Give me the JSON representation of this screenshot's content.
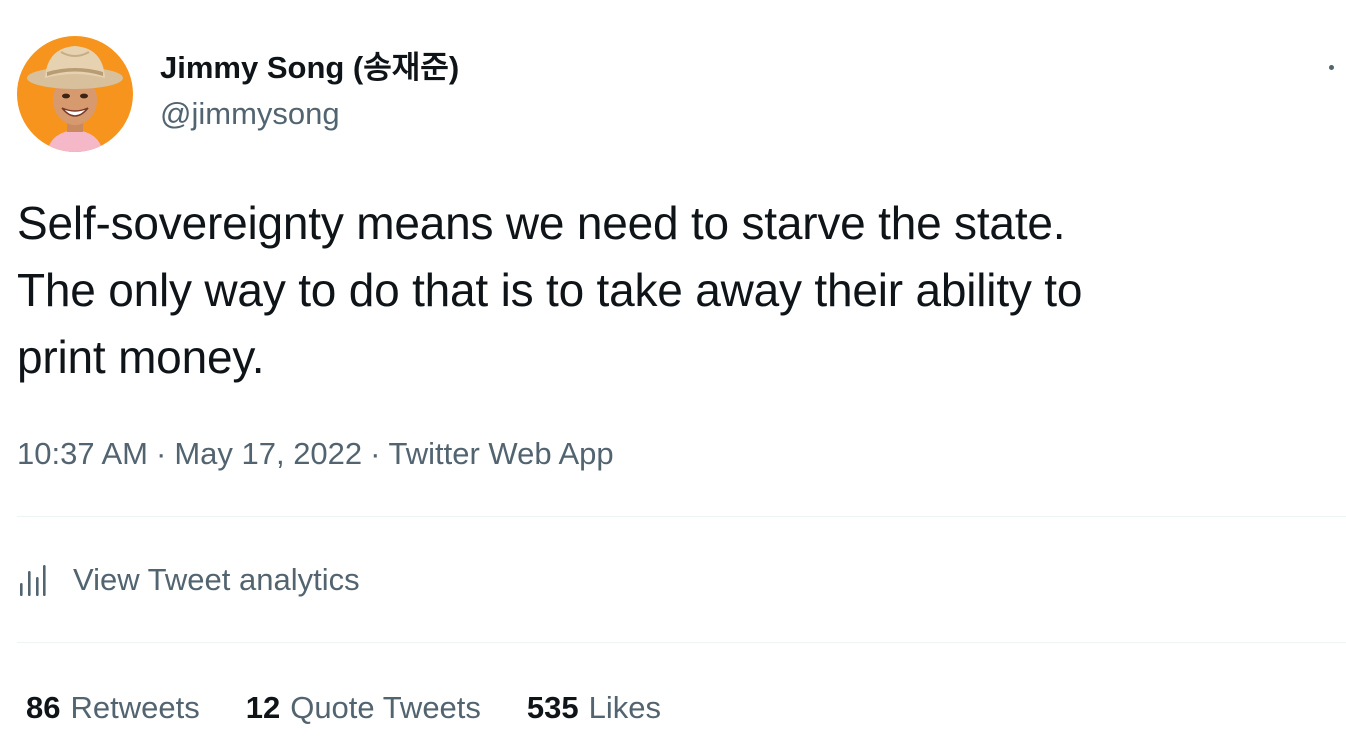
{
  "author": {
    "display_name": "Jimmy Song (송재준)",
    "handle": "@jimmysong"
  },
  "tweet": {
    "lines": [
      "Self-sovereignty means we need to starve the state.",
      "The only way to do that is to take away their ability to",
      "print money."
    ]
  },
  "meta": {
    "time": "10:37 AM",
    "separator": "·",
    "date": "May 17, 2022",
    "source": "Twitter Web App"
  },
  "analytics": {
    "icon": "analytics-bars-icon",
    "label": "View Tweet analytics"
  },
  "stats": [
    {
      "count": "86",
      "label": "Retweets"
    },
    {
      "count": "12",
      "label": "Quote Tweets"
    },
    {
      "count": "535",
      "label": "Likes"
    }
  ],
  "colors": {
    "text_primary": "#0f1419",
    "text_secondary": "#536471",
    "divider": "#eff3f4",
    "avatar_background": "#f7941d"
  }
}
